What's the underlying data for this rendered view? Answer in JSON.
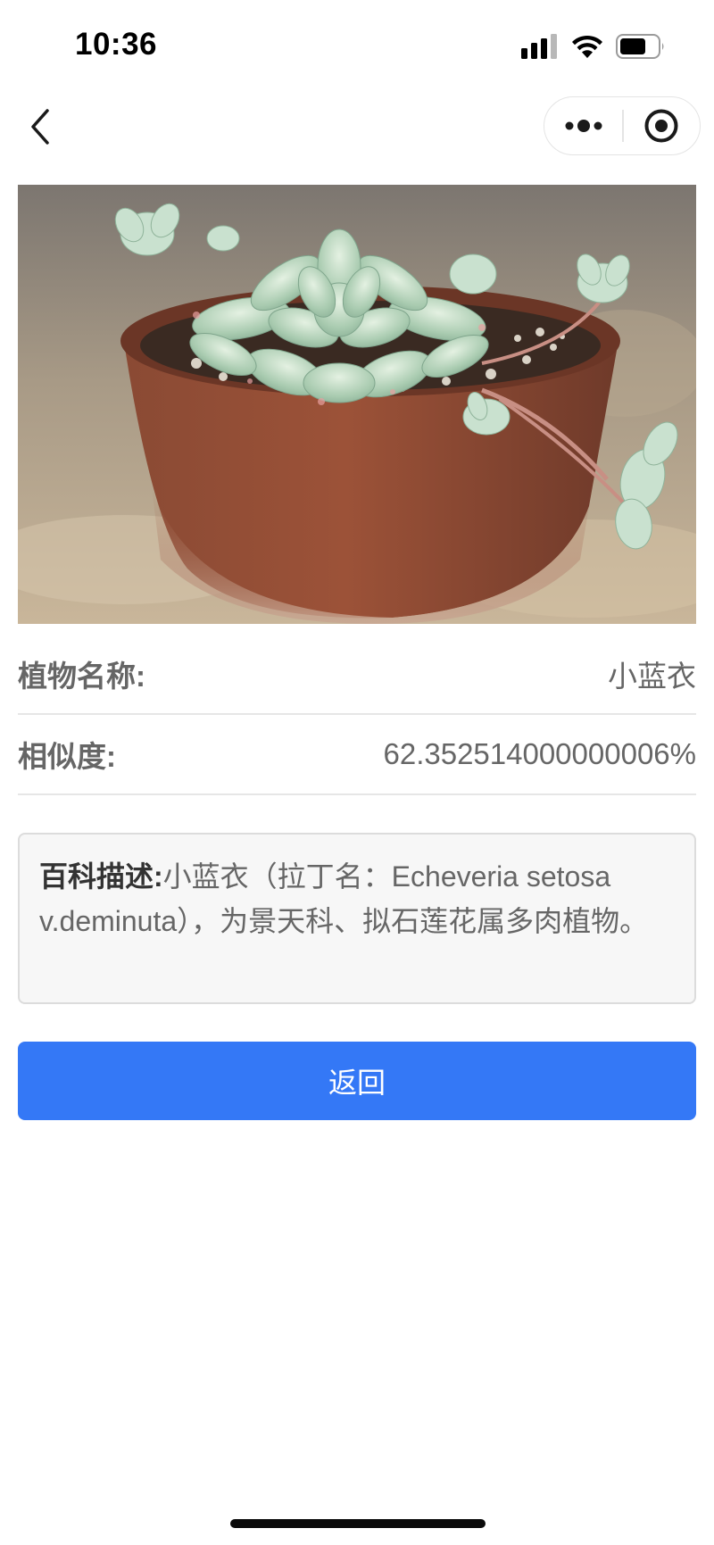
{
  "status_bar": {
    "time": "10:36",
    "icons": [
      "signal-icon",
      "wifi-icon",
      "battery-icon"
    ],
    "battery_level": 0.6
  },
  "nav": {
    "icons": [
      "back-chevron-icon",
      "more-dots-icon",
      "close-target-icon"
    ]
  },
  "photo": {
    "subject": "succulent-in-terracotta-pot"
  },
  "result": {
    "name_label": "植物名称:",
    "name_value": "小蓝衣",
    "similarity_label": "相似度:",
    "similarity_value": "62.352514000000006%"
  },
  "description": {
    "label": "百科描述:",
    "text": "小蓝衣（拉丁名：Echeveria setosa v.deminuta），为景天科、拟石莲花属多肉植物。"
  },
  "actions": {
    "return_label": "返回"
  },
  "colors": {
    "primary_button": "#3478f6",
    "text_muted": "#666666",
    "divider": "#e6e6e6",
    "description_bg": "#f7f7f7"
  }
}
